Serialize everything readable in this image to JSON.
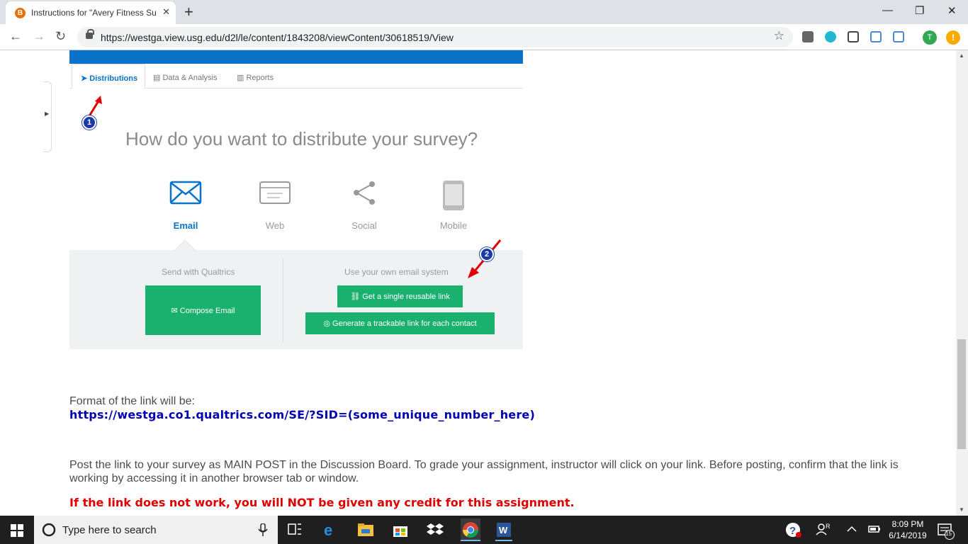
{
  "browser": {
    "tab_title": "Instructions for \"Avery Fitness Su",
    "tab_favicon_letter": "B",
    "url": "https://westga.view.usg.edu/d2l/le/content/1843208/viewContent/30618519/View",
    "profile_initial": "T",
    "alert_symbol": "!"
  },
  "qualtrics": {
    "tabs": [
      "Distributions",
      "Data & Analysis",
      "Reports"
    ],
    "question": "How do you want to distribute your survey?",
    "options": [
      "Email",
      "Web",
      "Social",
      "Mobile"
    ],
    "left_panel_title": "Send with Qualtrics",
    "compose_button": "Compose Email",
    "right_panel_title": "Use your own email system",
    "reusable_link_button": "Get a single reusable link",
    "trackable_link_button": "Generate a trackable link for each contact",
    "markers": [
      "1",
      "2"
    ]
  },
  "page": {
    "format_text": "Format of the link will be:",
    "format_link": "https://westga.co1.qualtrics.com/SE/?SID=(some_unique_number_here)",
    "instructions": "Post the link to your survey as MAIN POST in the Discussion Board. To grade your assignment, instructor will click on your link. Before posting, confirm that the link is working by accessing it in another browser tab or window.",
    "warning": "If the link does not work, you will NOT be given any credit for this assignment."
  },
  "taskbar": {
    "search_placeholder": "Type here to search",
    "time": "8:09 PM",
    "date": "6/14/2019",
    "notification_count": "15"
  },
  "colors": {
    "qualtrics_blue": "#0a73c9",
    "qualtrics_green": "#1ab06e",
    "warning_red": "#e00000",
    "link_blue": "#0000b3",
    "marker_blue": "#1a3aa8"
  }
}
